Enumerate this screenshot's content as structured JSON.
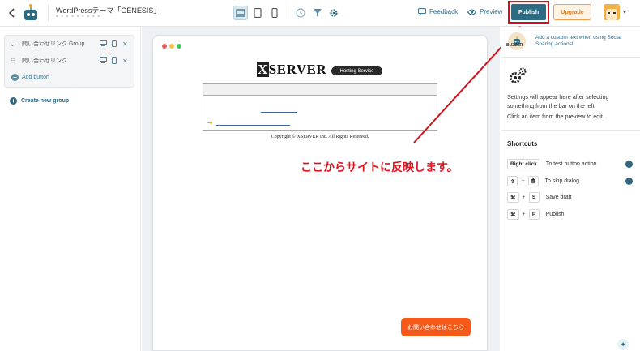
{
  "header": {
    "title": "WordPressテーマ「GENESIS」",
    "subtitle": "▪ ▪ ▪ ▪ ▪ ▪ ▪ ▪ ▪",
    "feedback_label": "Feedback",
    "preview_label": "Preview",
    "publish_label": "Publish",
    "upgrade_label": "Upgrade"
  },
  "left_panel": {
    "group": {
      "name": "問い合わせリンク Group",
      "item": "問い合わせリンク",
      "add_button": "Add button"
    },
    "create_group_label": "Create new group"
  },
  "canvas": {
    "logo_text": "SERVER",
    "logo_x": "X",
    "logo_badge": "Hosting Service",
    "copyright": "Copyright © XSERVER Inc. All Rights Reserved.",
    "annotation": "ここからサイトに反映します。",
    "floating_button": "お問い合わせはこちら"
  },
  "right_panel": {
    "buzzer_label": "BUZZER",
    "promo_text": "Add a custom text when using Social Sharing actions!",
    "settings_text": "Settings will appear here after selecting something from the bar on the left.",
    "click_text": "Click an item from the preview to edit.",
    "shortcuts_title": "Shortcuts",
    "shortcuts": [
      {
        "keys": [
          "Right click"
        ],
        "label": "To test button action"
      },
      {
        "keys": [
          "⇧",
          "🖱"
        ],
        "label": "To skip dialog"
      },
      {
        "keys": [
          "⌘",
          "S"
        ],
        "label": "Save draft"
      },
      {
        "keys": [
          "⌘",
          "P"
        ],
        "label": "Publish"
      }
    ]
  },
  "colors": {
    "accent": "#2c6b82",
    "annotation_red": "#e0141e",
    "upgrade_orange": "#e27b22",
    "float_button": "#f55a1a"
  }
}
